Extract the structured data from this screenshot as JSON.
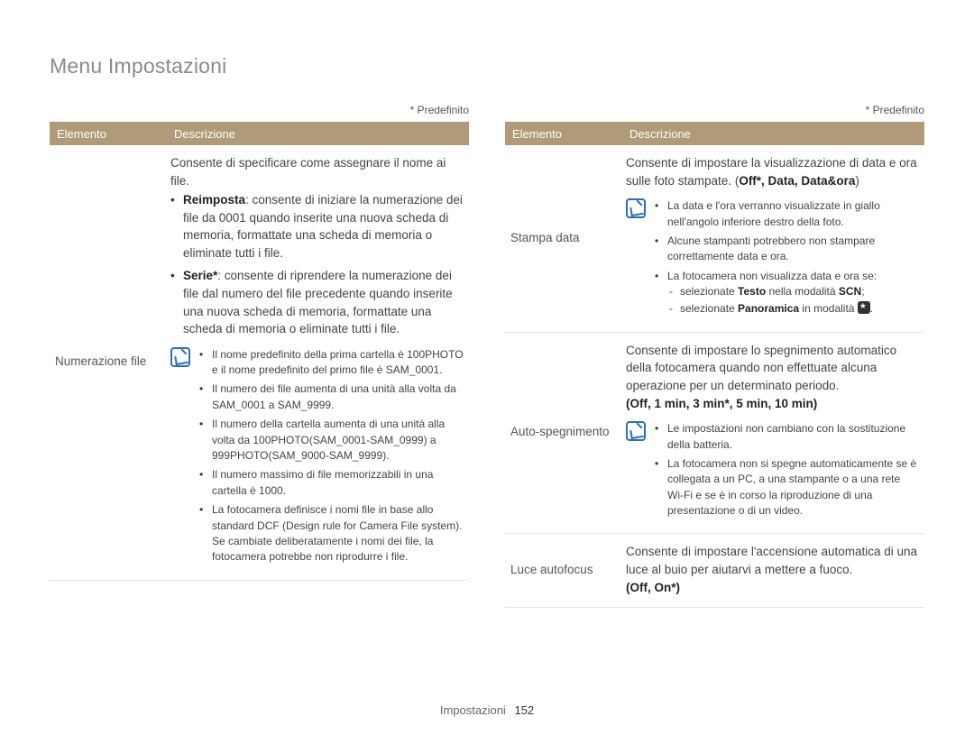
{
  "page_title": "Menu Impostazioni",
  "predef_label": "* Predefinito",
  "table_headers": {
    "element": "Elemento",
    "description": "Descrizione"
  },
  "footer": {
    "section": "Impostazioni",
    "page": "152"
  },
  "left": {
    "row1": {
      "element": "Numerazione file",
      "intro": "Consente di specificare come assegnare il nome ai file.",
      "bullets": [
        {
          "label": "Reimposta",
          "text": ": consente di iniziare la numerazione dei file da 0001 quando inserite una nuova scheda di memoria, formattate una scheda di memoria o eliminate tutti i file."
        },
        {
          "label": "Serie*",
          "text": ": consente di riprendere la numerazione dei file dal numero del file precedente quando inserite una nuova scheda di memoria, formattate una scheda di memoria o eliminate tutti i file."
        }
      ],
      "note_bullets": [
        "Il nome predefinito della prima cartella è 100PHOTO e il nome predefinito del primo file è SAM_0001.",
        "Il numero dei file aumenta di una unità alla volta da SAM_0001 a SAM_9999.",
        "Il numero della cartella aumenta di una unità alla volta da 100PHOTO(SAM_0001-SAM_0999) a 999PHOTO(SAM_9000-SAM_9999).",
        "Il numero massimo di file memorizzabili in una cartella è 1000.",
        "La fotocamera definisce i nomi file in base allo standard DCF (Design rule for Camera File system). Se cambiate deliberatamente i nomi dei file, la fotocamera potrebbe non riprodurre i file."
      ]
    }
  },
  "right": {
    "row1": {
      "element": "Stampa data",
      "intro_a": "Consente di impostare la visualizzazione di data e ora sulle foto stampate. (",
      "opts": "Off*, Data, Data&ora",
      "intro_b": ")",
      "note_bullets": [
        "La data e l'ora verranno visualizzate in giallo nell'angolo inferiore destro della foto.",
        "Alcune stampanti potrebbero non stampare correttamente data e ora."
      ],
      "note_bullet3_pre": "La fotocamera non visualizza data e ora se:",
      "note_dash": [
        {
          "pre": "selezionate ",
          "bold": "Testo",
          "mid": " nella modalità ",
          "bold2": "SCN",
          "post": ";"
        },
        {
          "pre": "selezionate ",
          "bold": "Panoramica",
          "mid": " in modalità ",
          "icon": true,
          "post": "."
        }
      ]
    },
    "row2": {
      "element": "Auto-spegnimento",
      "intro": "Consente di impostare lo spegnimento automatico della fotocamera quando non effettuate alcuna operazione per un determinato periodo.",
      "opts": "(Off, 1 min, 3 min*, 5 min, 10 min)",
      "note_bullets": [
        "Le impostazioni non cambiano con la sostituzione della batteria.",
        "La fotocamera non si spegne automaticamente se è collegata a un PC, a una stampante o a una rete Wi-Fi e se è in corso la riproduzione di una presentazione o di un video."
      ]
    },
    "row3": {
      "element": "Luce autofocus",
      "intro": "Consente di impostare l'accensione automatica di una luce al buio per aiutarvi a mettere a fuoco.",
      "opts": "(Off, On*)"
    }
  }
}
